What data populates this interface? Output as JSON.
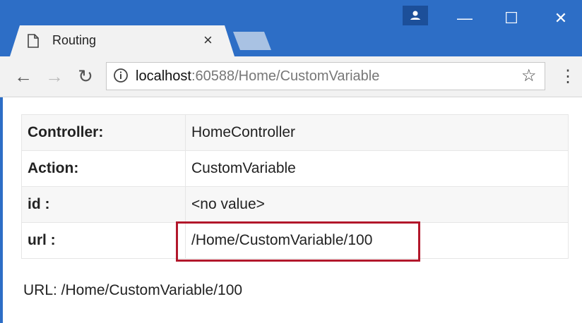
{
  "browser": {
    "tab_title": "Routing",
    "address": {
      "host": "localhost",
      "rest": ":60588/Home/CustomVariable"
    },
    "colors": {
      "frame": "#2d6ec6",
      "toolbar": "#f2f2f2",
      "highlight": "#b2172b"
    }
  },
  "table": {
    "rows": [
      {
        "label": "Controller:",
        "value": "HomeController"
      },
      {
        "label": "Action:",
        "value": "CustomVariable"
      },
      {
        "label": "id :",
        "value": "<no value>"
      },
      {
        "label": "url :",
        "value": "/Home/CustomVariable/100"
      }
    ]
  },
  "footer": {
    "url_line": "URL: /Home/CustomVariable/100"
  }
}
